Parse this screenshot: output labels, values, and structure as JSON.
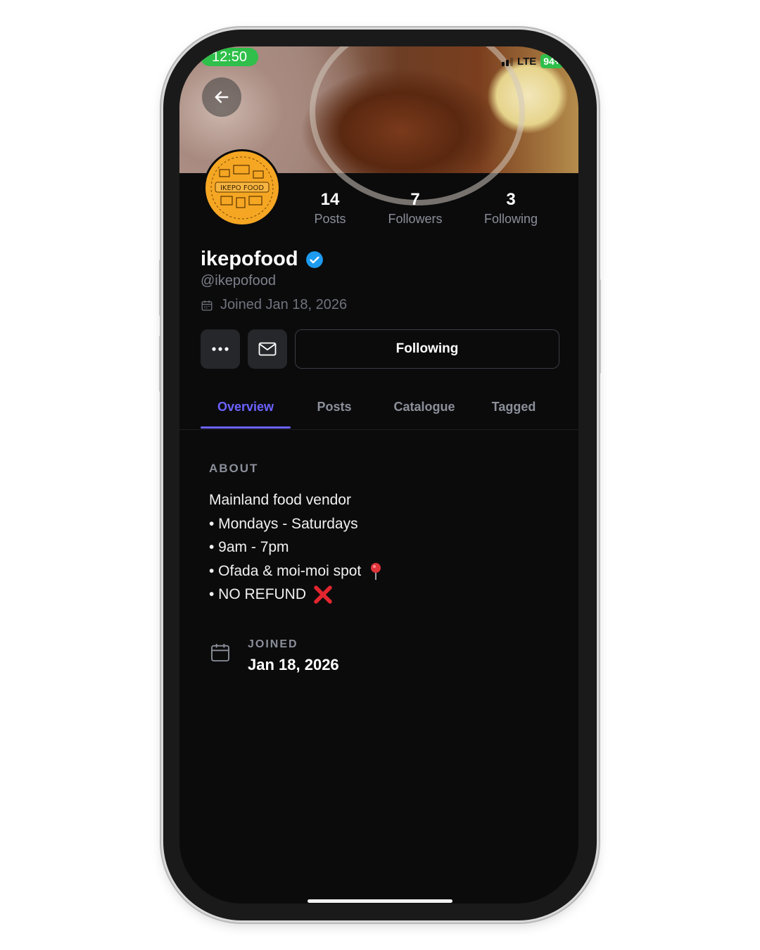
{
  "status_bar": {
    "time": "12:50",
    "network": "LTE",
    "battery": "94+"
  },
  "profile": {
    "avatar_text": "IKEPO FOOD",
    "display_name": "ikepofood",
    "handle": "@ikepofood",
    "joined_line": "Joined Jan 18, 2026",
    "stats": [
      {
        "value": "14",
        "label": "Posts"
      },
      {
        "value": "7",
        "label": "Followers"
      },
      {
        "value": "3",
        "label": "Following"
      }
    ],
    "follow_button": "Following"
  },
  "tabs": [
    {
      "label": "Overview",
      "active": true
    },
    {
      "label": "Posts",
      "active": false
    },
    {
      "label": "Catalogue",
      "active": false
    },
    {
      "label": "Tagged",
      "active": false
    }
  ],
  "about": {
    "heading": "ABOUT",
    "lines": [
      "Mainland food vendor",
      "• Mondays - Saturdays",
      "• 9am - 7pm",
      "• Ofada & moi-moi spot",
      "• NO REFUND"
    ]
  },
  "joined_section": {
    "label": "JOINED",
    "value": "Jan 18, 2026"
  },
  "colors": {
    "accent": "#6c63ff",
    "verified": "#1d9bf0",
    "avatar_bg": "#f5a623",
    "background": "#0b0b0c"
  }
}
